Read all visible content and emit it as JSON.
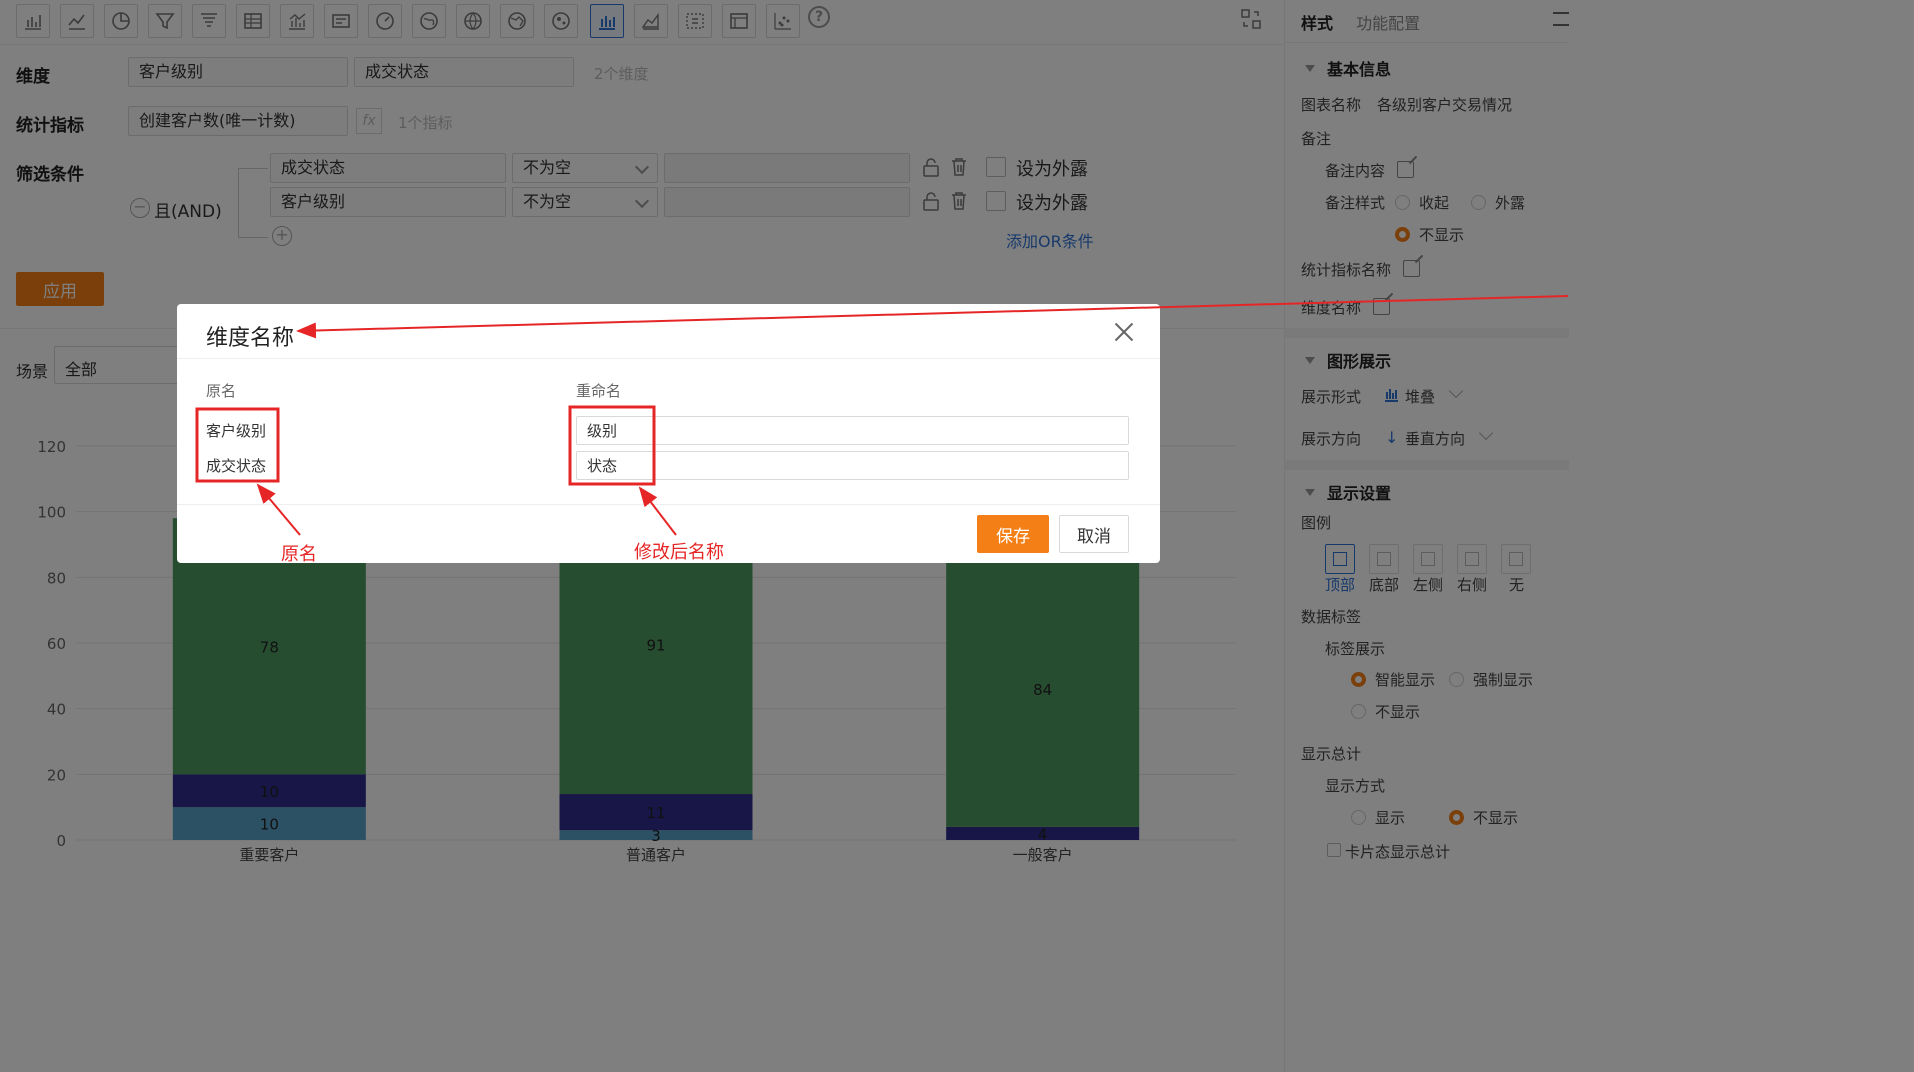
{
  "toolbar": {
    "icons": [
      "bar-chart-icon",
      "line-chart-icon",
      "pie-chart-icon",
      "funnel-icon",
      "funnel-alt-icon",
      "table-icon",
      "combo-chart-icon",
      "card-icon",
      "gauge-icon",
      "map-china-icon",
      "map-world-icon",
      "map-region-icon",
      "bubble-map-icon",
      "stacked-bar-icon",
      "area-chart-icon",
      "pivot-table-icon",
      "detail-table-icon",
      "scatter-icon"
    ],
    "active_icon": "stacked-bar-icon",
    "help_glyph": "?"
  },
  "config": {
    "dimension_label": "维度",
    "dimensions": [
      "客户级别",
      "成交状态"
    ],
    "dimension_count": "2个维度",
    "metric_label": "统计指标",
    "metric": "创建客户数(唯一计数)",
    "fx": "fx",
    "metric_count": "1个指标",
    "filter_label": "筛选条件",
    "logic": "且(AND)",
    "filters": [
      {
        "field": "成交状态",
        "op": "不为空",
        "external": "设为外露"
      },
      {
        "field": "客户级别",
        "op": "不为空",
        "external": "设为外露"
      }
    ],
    "add_or": "添加OR条件",
    "apply": "应用"
  },
  "scene": {
    "label": "场景",
    "value": "全部"
  },
  "chart_data": {
    "type": "bar",
    "stacked": true,
    "categories": [
      "重要客户",
      "普通客户",
      "一般客户"
    ],
    "series": [
      {
        "values": [
          10,
          3,
          0
        ],
        "color": "#5ba3c9"
      },
      {
        "values": [
          10,
          11,
          4
        ],
        "color": "#2f2d8c"
      },
      {
        "values": [
          78,
          91,
          84
        ],
        "color": "#4e9a62"
      }
    ],
    "data_labels": [
      [
        "10",
        "10",
        "78"
      ],
      [
        "3",
        "11",
        "91"
      ],
      [
        "",
        "4",
        "84"
      ]
    ],
    "y_ticks": [
      0,
      20,
      40,
      60,
      80,
      100,
      120
    ],
    "ylim": [
      0,
      120
    ],
    "grid": true
  },
  "right_panel": {
    "tabs": [
      "样式",
      "功能配置"
    ],
    "basic_info": "基本信息",
    "chart_name_label": "图表名称",
    "chart_name_value": "各级别客户交易情况",
    "remark": "备注",
    "remark_content": "备注内容",
    "remark_style": "备注样式",
    "remark_options": [
      "收起",
      "外露",
      "不显示"
    ],
    "metric_name": "统计指标名称",
    "dimension_name": "维度名称",
    "graphic_display": "图形展示",
    "display_form_label": "展示形式",
    "display_form_value": "堆叠",
    "display_dir_label": "展示方向",
    "display_dir_value": "垂直方向",
    "display_settings": "显示设置",
    "legend": "图例",
    "legend_options": [
      "顶部",
      "底部",
      "左侧",
      "右侧",
      "无"
    ],
    "data_label": "数据标签",
    "label_display": "标签展示",
    "label_options": [
      "智能显示",
      "强制显示",
      "不显示"
    ],
    "show_total": "显示总计",
    "display_mode": "显示方式",
    "total_options": [
      "显示",
      "不显示"
    ],
    "card_total": "卡片态显示总计"
  },
  "dialog": {
    "title": "维度名称",
    "col_original": "原名",
    "col_rename": "重命名",
    "originals": [
      "客户级别",
      "成交状态"
    ],
    "renames": [
      "级别",
      "状态"
    ],
    "save": "保存",
    "cancel": "取消"
  },
  "annotations": {
    "original_name": "原名",
    "renamed": "修改后名称",
    "color": "#e62626"
  }
}
